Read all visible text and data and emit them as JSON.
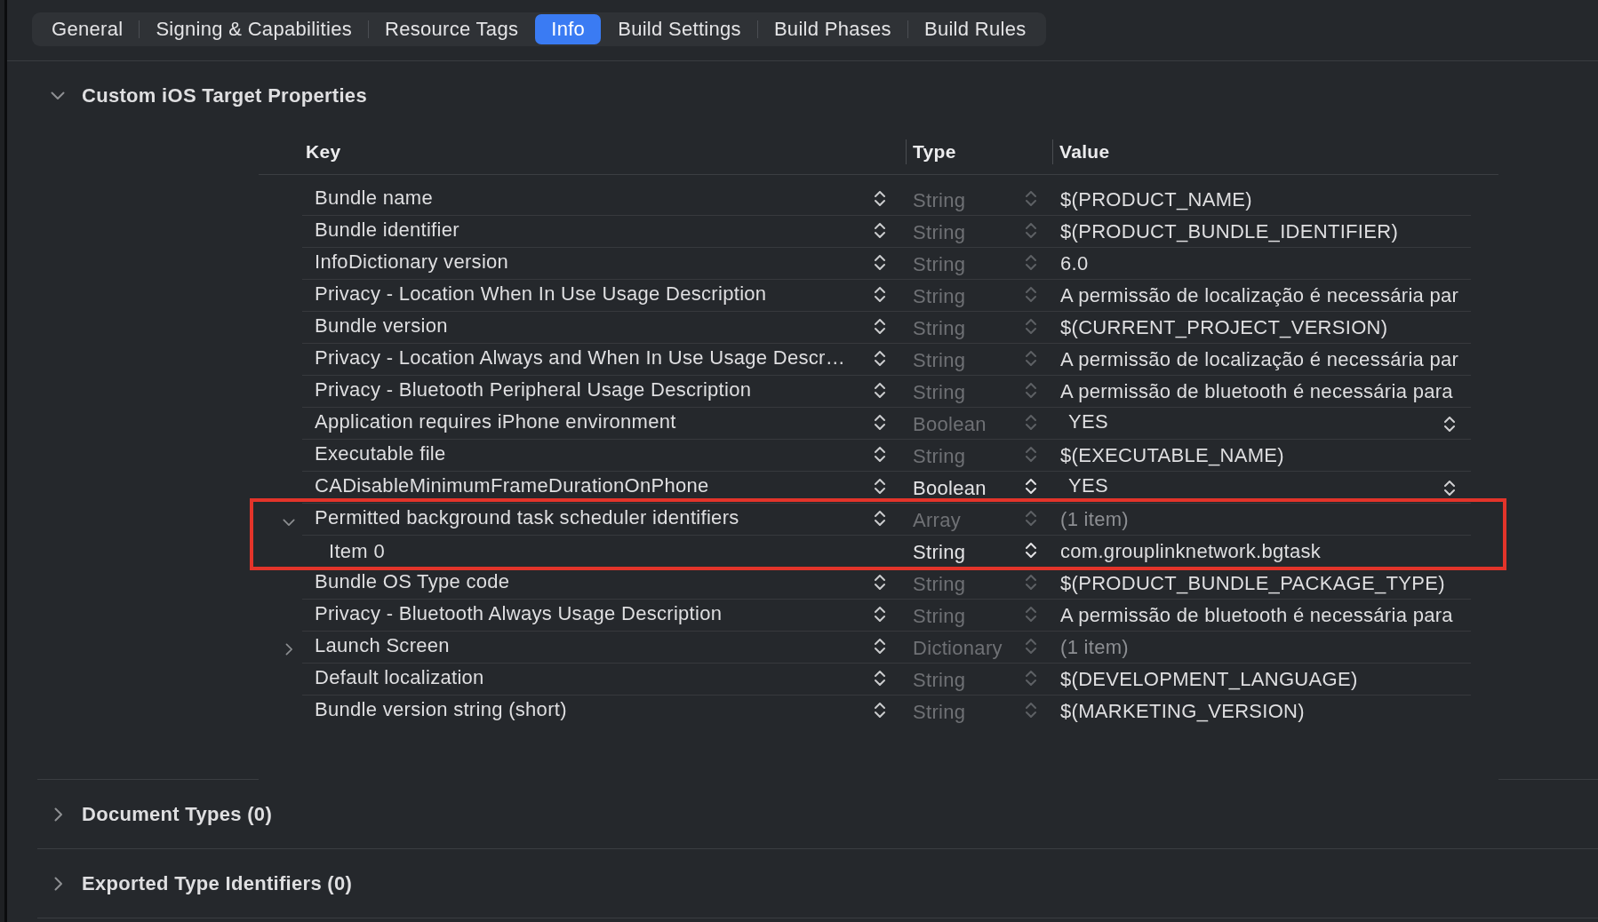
{
  "tabs": [
    {
      "label": "General",
      "selected": false
    },
    {
      "label": "Signing & Capabilities",
      "selected": false
    },
    {
      "label": "Resource Tags",
      "selected": false
    },
    {
      "label": "Info",
      "selected": true
    },
    {
      "label": "Build Settings",
      "selected": false
    },
    {
      "label": "Build Phases",
      "selected": false
    },
    {
      "label": "Build Rules",
      "selected": false
    }
  ],
  "sections": [
    {
      "title": "Custom iOS Target Properties",
      "expanded": true,
      "table": {
        "columns": [
          "Key",
          "Type",
          "Value"
        ],
        "rows": [
          {
            "key": "Bundle name",
            "type": "String",
            "value": "$(PRODUCT_NAME)",
            "kind": "text",
            "active": false,
            "annotated": false
          },
          {
            "key": "Bundle identifier",
            "type": "String",
            "value": "$(PRODUCT_BUNDLE_IDENTIFIER)",
            "kind": "text",
            "active": false,
            "annotated": false
          },
          {
            "key": "InfoDictionary version",
            "type": "String",
            "value": "6.0",
            "kind": "text",
            "active": false,
            "annotated": false
          },
          {
            "key": "Privacy - Location When In Use Usage Description",
            "type": "String",
            "value": "A permissão de localização é necessária par",
            "kind": "text",
            "active": false,
            "annotated": false
          },
          {
            "key": "Bundle version",
            "type": "String",
            "value": "$(CURRENT_PROJECT_VERSION)",
            "kind": "text",
            "active": false,
            "annotated": false
          },
          {
            "key": "Privacy - Location Always and When In Use Usage Descr…",
            "type": "String",
            "value": "A permissão de localização é necessária par",
            "kind": "text",
            "active": false,
            "annotated": false
          },
          {
            "key": "Privacy - Bluetooth Peripheral Usage Description",
            "type": "String",
            "value": "A permissão de bluetooth é necessária para",
            "kind": "text",
            "active": false,
            "annotated": false
          },
          {
            "key": "Application requires iPhone environment",
            "type": "Boolean",
            "value": "YES",
            "kind": "popup",
            "active": false,
            "annotated": false
          },
          {
            "key": "Executable file",
            "type": "String",
            "value": "$(EXECUTABLE_NAME)",
            "kind": "text",
            "active": false,
            "annotated": false
          },
          {
            "key": "CADisableMinimumFrameDurationOnPhone",
            "type": "Boolean",
            "value": "YES",
            "kind": "popup",
            "active": true,
            "annotated": false
          },
          {
            "key": "Permitted background task scheduler identifiers",
            "type": "Array",
            "value": "(1 item)",
            "kind": "collection",
            "expanded": true,
            "active": false,
            "annotated": true,
            "children": [
              {
                "key": "Item 0",
                "type": "String",
                "value": "com.grouplinknetwork.bgtask",
                "kind": "text",
                "active": true,
                "annotated": false
              }
            ]
          },
          {
            "key": "Bundle OS Type code",
            "type": "String",
            "value": "$(PRODUCT_BUNDLE_PACKAGE_TYPE)",
            "kind": "text",
            "active": false,
            "annotated": false
          },
          {
            "key": "Privacy - Bluetooth Always Usage Description",
            "type": "String",
            "value": "A permissão de bluetooth é necessária para",
            "kind": "text",
            "active": false,
            "annotated": false
          },
          {
            "key": "Launch Screen",
            "type": "Dictionary",
            "value": "(1 item)",
            "kind": "collection",
            "expanded": false,
            "active": false,
            "annotated": false
          },
          {
            "key": "Default localization",
            "type": "String",
            "value": "$(DEVELOPMENT_LANGUAGE)",
            "kind": "text",
            "active": false,
            "annotated": false
          },
          {
            "key": "Bundle version string (short)",
            "type": "String",
            "value": "$(MARKETING_VERSION)",
            "kind": "text",
            "active": false,
            "annotated": false
          }
        ]
      }
    },
    {
      "title": "Document Types (0)",
      "expanded": false
    },
    {
      "title": "Exported Type Identifiers (0)",
      "expanded": false
    }
  ]
}
